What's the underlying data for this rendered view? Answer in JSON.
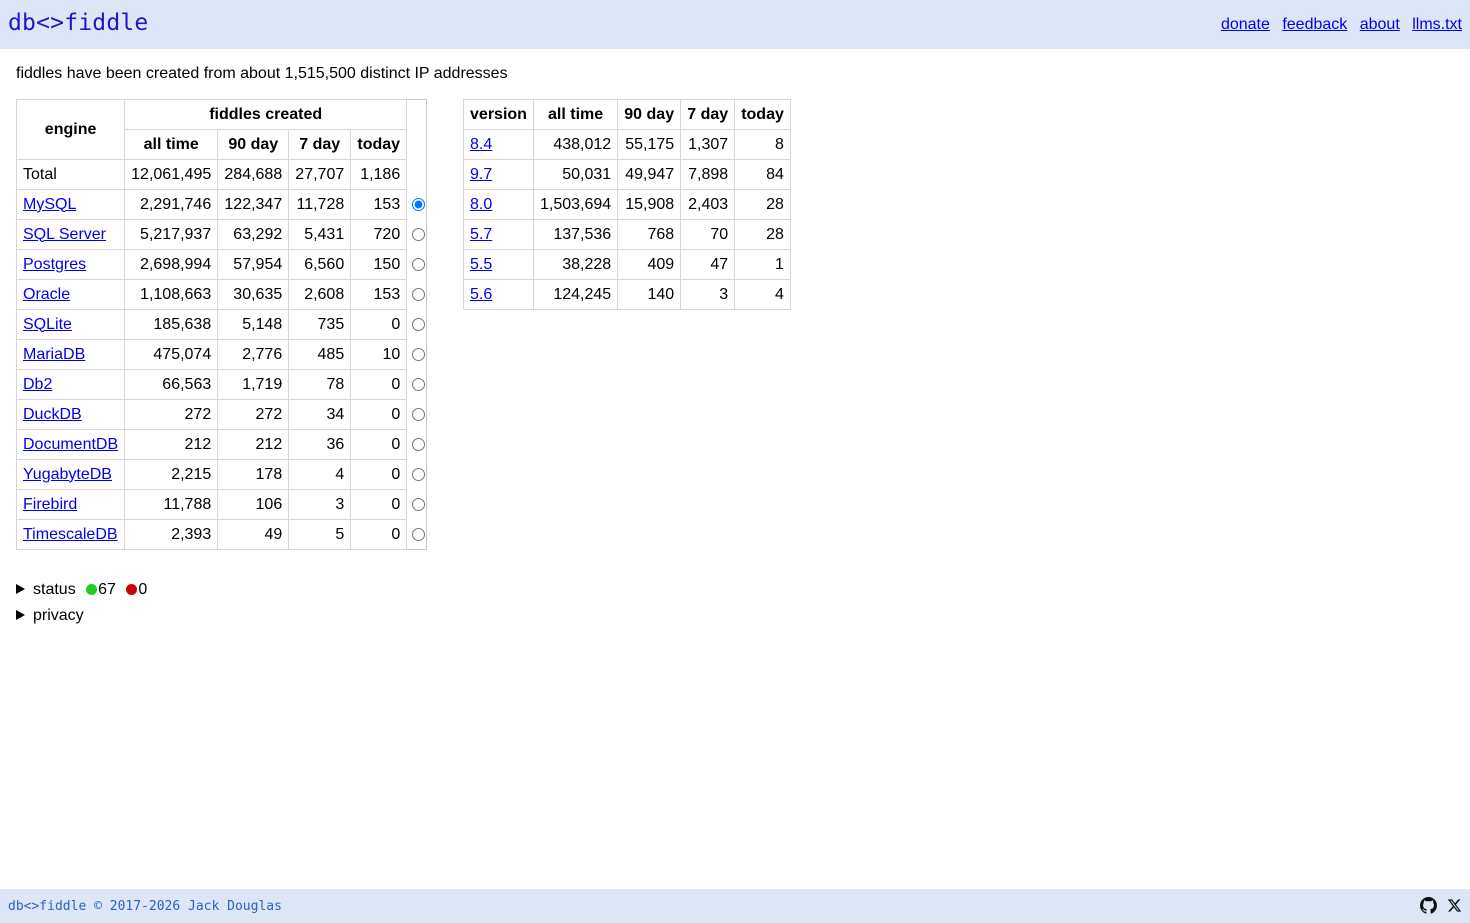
{
  "header": {
    "brand": "db<>fiddle",
    "nav": [
      "donate",
      "feedback",
      "about",
      "llms.txt"
    ]
  },
  "intro": "fiddles have been created from about 1,515,500 distinct IP addresses",
  "engines_table": {
    "header_engine": "engine",
    "header_group": "fiddles created",
    "columns": [
      "all time",
      "90 day",
      "7 day",
      "today"
    ],
    "rows": [
      {
        "name": "Total",
        "all_time": "12,061,495",
        "d90": "284,688",
        "d7": "27,707",
        "today": "1,186"
      },
      {
        "name": "MySQL",
        "all_time": "2,291,746",
        "d90": "122,347",
        "d7": "11,728",
        "today": "153"
      },
      {
        "name": "SQL Server",
        "all_time": "5,217,937",
        "d90": "63,292",
        "d7": "5,431",
        "today": "720"
      },
      {
        "name": "Postgres",
        "all_time": "2,698,994",
        "d90": "57,954",
        "d7": "6,560",
        "today": "150"
      },
      {
        "name": "Oracle",
        "all_time": "1,108,663",
        "d90": "30,635",
        "d7": "2,608",
        "today": "153"
      },
      {
        "name": "SQLite",
        "all_time": "185,638",
        "d90": "5,148",
        "d7": "735",
        "today": "0"
      },
      {
        "name": "MariaDB",
        "all_time": "475,074",
        "d90": "2,776",
        "d7": "485",
        "today": "10"
      },
      {
        "name": "Db2",
        "all_time": "66,563",
        "d90": "1,719",
        "d7": "78",
        "today": "0"
      },
      {
        "name": "DuckDB",
        "all_time": "272",
        "d90": "272",
        "d7": "34",
        "today": "0"
      },
      {
        "name": "DocumentDB",
        "all_time": "212",
        "d90": "212",
        "d7": "36",
        "today": "0"
      },
      {
        "name": "YugabyteDB",
        "all_time": "2,215",
        "d90": "178",
        "d7": "4",
        "today": "0"
      },
      {
        "name": "Firebird",
        "all_time": "11,788",
        "d90": "106",
        "d7": "3",
        "today": "0"
      },
      {
        "name": "TimescaleDB",
        "all_time": "2,393",
        "d90": "49",
        "d7": "5",
        "today": "0"
      }
    ],
    "selected_engine": "MySQL"
  },
  "versions_table": {
    "columns": [
      "version",
      "all time",
      "90 day",
      "7 day",
      "today"
    ],
    "rows": [
      {
        "version": "8.4",
        "all_time": "438,012",
        "d90": "55,175",
        "d7": "1,307",
        "today": "8"
      },
      {
        "version": "9.7",
        "all_time": "50,031",
        "d90": "49,947",
        "d7": "7,898",
        "today": "84"
      },
      {
        "version": "8.0",
        "all_time": "1,503,694",
        "d90": "15,908",
        "d7": "2,403",
        "today": "28"
      },
      {
        "version": "5.7",
        "all_time": "137,536",
        "d90": "768",
        "d7": "70",
        "today": "28"
      },
      {
        "version": "5.5",
        "all_time": "38,228",
        "d90": "409",
        "d7": "47",
        "today": "1"
      },
      {
        "version": "5.6",
        "all_time": "124,245",
        "d90": "140",
        "d7": "3",
        "today": "4"
      }
    ]
  },
  "status": {
    "label": "status",
    "ok_count": "67",
    "fail_count": "0",
    "ok_color": "#22cc22",
    "fail_color": "#cc0000"
  },
  "privacy": {
    "label": "privacy"
  },
  "footer": {
    "copyright": "db<>fiddle © 2017-2026 Jack Douglas",
    "icons": [
      "github-icon",
      "x-icon"
    ]
  }
}
